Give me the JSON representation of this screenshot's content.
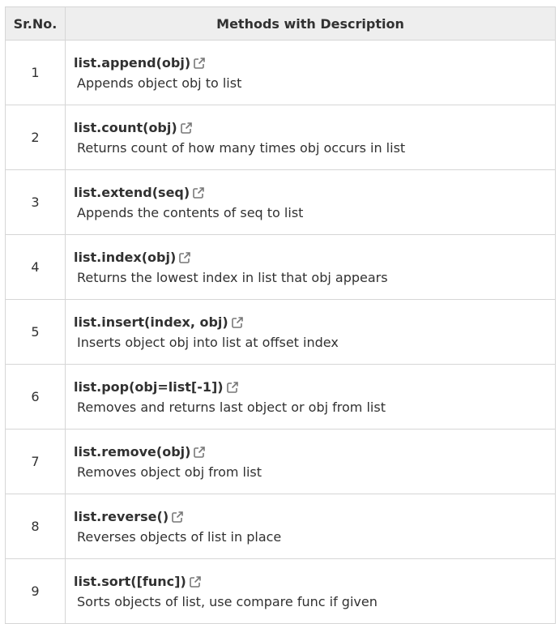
{
  "table": {
    "headers": [
      "Sr.No.",
      "Methods with Description"
    ],
    "rows": [
      {
        "no": "1",
        "method": "list.append(obj)",
        "description": "Appends object obj to list"
      },
      {
        "no": "2",
        "method": "list.count(obj)",
        "description": "Returns count of how many times obj occurs in list"
      },
      {
        "no": "3",
        "method": "list.extend(seq)",
        "description": "Appends the contents of seq to list"
      },
      {
        "no": "4",
        "method": "list.index(obj)",
        "description": "Returns the lowest index in list that obj appears"
      },
      {
        "no": "5",
        "method": "list.insert(index, obj)",
        "description": "Inserts object obj into list at offset index"
      },
      {
        "no": "6",
        "method": "list.pop(obj=list[-1])",
        "description": "Removes and returns last object or obj from list"
      },
      {
        "no": "7",
        "method": "list.remove(obj)",
        "description": "Removes object obj from list"
      },
      {
        "no": "8",
        "method": "list.reverse()",
        "description": "Reverses objects of list in place"
      },
      {
        "no": "9",
        "method": "list.sort([func])",
        "description": "Sorts objects of list, use compare func if given"
      }
    ]
  },
  "icons": {
    "external_link": "external-link-icon"
  },
  "colors": {
    "header_bg": "#eeeeee",
    "border": "#d6d6d6",
    "text": "#313131"
  }
}
